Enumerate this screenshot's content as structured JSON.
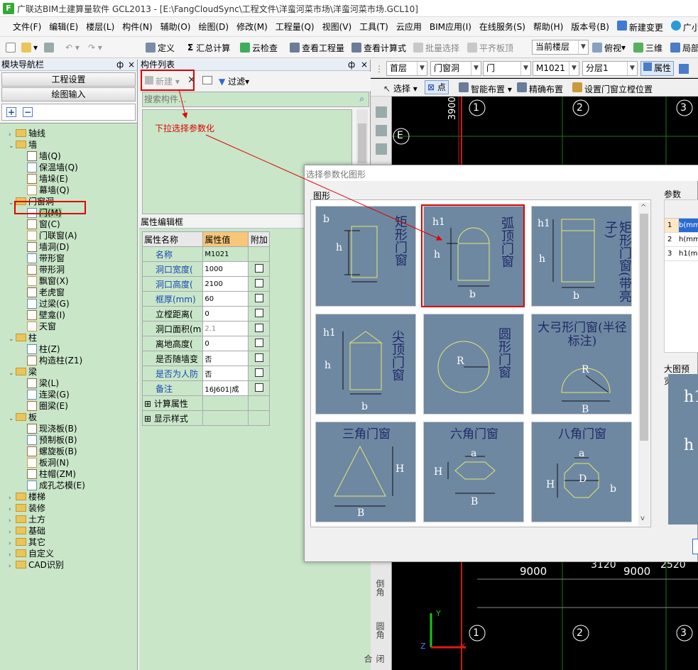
{
  "app": {
    "title": "广联达BIM土建算量软件 GCL2013 - [E:\\FangCloudSync\\工程文件\\洋蛮河菜市场\\洋蛮河菜市场.GCL10]",
    "icon_letter": "F"
  },
  "menu": [
    "文件(F)",
    "编辑(E)",
    "楼层(L)",
    "构件(N)",
    "辅助(O)",
    "绘图(D)",
    "修改(M)",
    "工程量(Q)",
    "视图(V)",
    "工具(T)",
    "云应用",
    "BIM应用(I)",
    "在线服务(S)",
    "帮助(H)",
    "版本号(B)",
    "新建变更",
    "广小二"
  ],
  "toolbar": {
    "define": "定义",
    "sum": "汇总计算",
    "cloud_check": "云检查",
    "view_qty": "查看工程量",
    "view_formula": "查看计算式",
    "batch_select": "批量选择",
    "flat_roof": "平齐板顶",
    "floor_scope": "当前楼层",
    "view_mode": "俯视",
    "three_d": "三维",
    "partial": "局部"
  },
  "nav": {
    "header": "模块导航栏",
    "pin": "ф",
    "close": "×",
    "project_settings": "工程设置",
    "draw_input": "绘图输入",
    "expand": "+",
    "collapse": "−",
    "tree": [
      {
        "label": "轴线",
        "level": 0,
        "toggle": ">"
      },
      {
        "label": "墙",
        "level": 0,
        "toggle": "v"
      },
      {
        "label": "墙(Q)",
        "level": 1
      },
      {
        "label": "保温墙(Q)",
        "level": 1
      },
      {
        "label": "墙垛(E)",
        "level": 1
      },
      {
        "label": "幕墙(Q)",
        "level": 1
      },
      {
        "label": "门窗洞",
        "level": 0,
        "toggle": "v"
      },
      {
        "label": "门(M)",
        "level": 1,
        "selected": true
      },
      {
        "label": "窗(C)",
        "level": 1
      },
      {
        "label": "门联窗(A)",
        "level": 1
      },
      {
        "label": "墙洞(D)",
        "level": 1
      },
      {
        "label": "带形窗",
        "level": 1
      },
      {
        "label": "带形洞",
        "level": 1
      },
      {
        "label": "飘窗(X)",
        "level": 1
      },
      {
        "label": "老虎窗",
        "level": 1
      },
      {
        "label": "过梁(G)",
        "level": 1
      },
      {
        "label": "壁龛(I)",
        "level": 1
      },
      {
        "label": "天窗",
        "level": 1
      },
      {
        "label": "柱",
        "level": 0,
        "toggle": "v"
      },
      {
        "label": "柱(Z)",
        "level": 1
      },
      {
        "label": "构造柱(Z1)",
        "level": 1
      },
      {
        "label": "梁",
        "level": 0,
        "toggle": "v"
      },
      {
        "label": "梁(L)",
        "level": 1
      },
      {
        "label": "连梁(G)",
        "level": 1
      },
      {
        "label": "圈梁(E)",
        "level": 1
      },
      {
        "label": "板",
        "level": 0,
        "toggle": "v"
      },
      {
        "label": "现浇板(B)",
        "level": 1
      },
      {
        "label": "预制板(B)",
        "level": 1
      },
      {
        "label": "螺旋板(B)",
        "level": 1
      },
      {
        "label": "板洞(N)",
        "level": 1
      },
      {
        "label": "柱帽(ZM)",
        "level": 1
      },
      {
        "label": "成孔芯模(E)",
        "level": 1
      },
      {
        "label": "楼梯",
        "level": 0,
        "toggle": ">"
      },
      {
        "label": "装修",
        "level": 0,
        "toggle": ">"
      },
      {
        "label": "土方",
        "level": 0,
        "toggle": ">"
      },
      {
        "label": "基础",
        "level": 0,
        "toggle": ">"
      },
      {
        "label": "其它",
        "level": 0,
        "toggle": ">"
      },
      {
        "label": "自定义",
        "level": 0,
        "toggle": ">"
      },
      {
        "label": "CAD识别",
        "level": 0,
        "toggle": ">"
      }
    ]
  },
  "complist": {
    "header": "构件列表",
    "pin": "ф",
    "close": "×",
    "new_label": "新建",
    "delete": "✕",
    "filter": "过滤",
    "search_placeholder": "搜索构件..."
  },
  "annotation": {
    "text": "下拉选择参数化"
  },
  "props": {
    "header": "属性编辑框",
    "pin": "ф",
    "close": "×",
    "col_name": "属性名称",
    "col_value": "属性值",
    "col_extra": "附加",
    "rows": [
      {
        "name": "名称",
        "value": "M1021",
        "blue": true,
        "checkbox": false
      },
      {
        "name": "洞口宽度(",
        "value": "1000",
        "blue": true,
        "checkbox": true
      },
      {
        "name": "洞口高度(",
        "value": "2100",
        "blue": true,
        "checkbox": true
      },
      {
        "name": "框厚(mm)",
        "value": "60",
        "blue": true,
        "checkbox": true
      },
      {
        "name": "立樘距离(",
        "value": "0",
        "blue": false,
        "checkbox": true
      },
      {
        "name": "洞口面积(m",
        "value": "2.1",
        "gray": true,
        "checkbox": true
      },
      {
        "name": "离地高度(",
        "value": "0",
        "blue": false,
        "checkbox": true
      },
      {
        "name": "是否随墙变",
        "value": "否",
        "blue": false,
        "checkbox": true
      },
      {
        "name": "是否为人防",
        "value": "否",
        "blue": true,
        "checkbox": true
      },
      {
        "name": "备注",
        "value": "16J601|成",
        "blue": true,
        "checkbox": true
      },
      {
        "name": "计算属性",
        "group": true
      },
      {
        "name": "显示样式",
        "group": true
      }
    ]
  },
  "layer_bar": {
    "floor": "首层",
    "category": "门窗洞",
    "type": "门",
    "component": "M1021",
    "layer": "分层1",
    "property": "属性"
  },
  "draw_bar": {
    "select": "选择",
    "point": "点",
    "smart": "智能布置",
    "precise": "精确布置",
    "set_pos": "设置门窗立樘位置"
  },
  "side_tools": [
    "倒角",
    "圆角",
    "闭合"
  ],
  "canvas": {
    "axis_top": [
      "1",
      "2",
      "3"
    ],
    "axis_bottom": [
      "1",
      "2",
      "3"
    ],
    "axis_left": "E",
    "dim_top": "3900",
    "dims_bottom": [
      "9000",
      "3120",
      "9000",
      "2520"
    ],
    "y_axis": "Y",
    "x_axis": "X",
    "z_axis": "Z"
  },
  "dialog": {
    "title": "选择参数化图形",
    "group_shapes": "图形",
    "group_params": "参数",
    "preview_label": "大图预览",
    "params": [
      {
        "no": "1",
        "name": "b(mm"
      },
      {
        "no": "2",
        "name": "h(mm"
      },
      {
        "no": "3",
        "name": "h1(m"
      }
    ],
    "preview_texts": [
      "h1",
      "h"
    ],
    "shapes": [
      {
        "name": "矩形门窗",
        "labels": [
          "h",
          "b"
        ]
      },
      {
        "name": "弧顶门窗",
        "labels": [
          "h1",
          "h",
          "b"
        ],
        "selected": true
      },
      {
        "name": "矩形门窗(带亮子)",
        "labels": [
          "h1",
          "h",
          "b"
        ]
      },
      {
        "name": "尖顶门窗",
        "labels": [
          "h1",
          "h",
          "b"
        ]
      },
      {
        "name": "圆形门窗",
        "labels": [
          "R"
        ]
      },
      {
        "name": "大弓形门窗(半径标注)",
        "labels": [
          "R",
          "B"
        ]
      },
      {
        "name": "三角门窗",
        "labels": [
          "H",
          "B"
        ]
      },
      {
        "name": "六角门窗",
        "labels": [
          "a",
          "H",
          "B"
        ]
      },
      {
        "name": "八角门窗",
        "labels": [
          "a",
          "H",
          "D",
          "b"
        ]
      }
    ],
    "scroll_up": "^",
    "scroll_down": "v"
  },
  "colors": {
    "tree_bg": "#c9e6c9",
    "cell_bg": "#6e88a2",
    "highlight": "#e00000",
    "shape_line": "#e6e66a"
  }
}
